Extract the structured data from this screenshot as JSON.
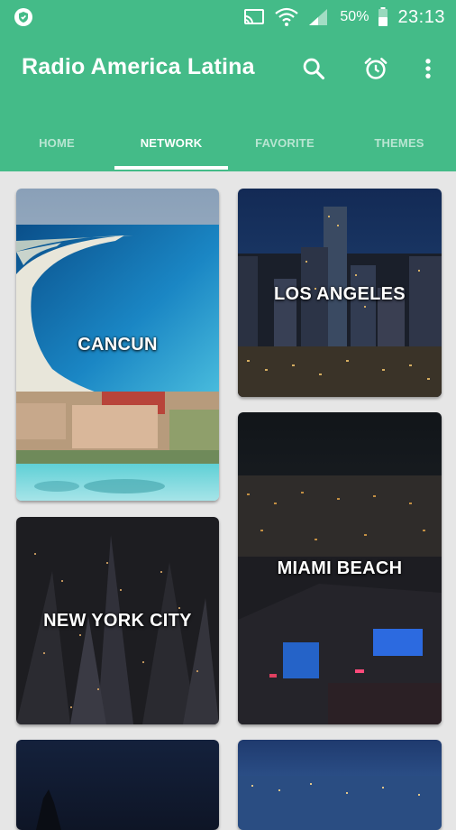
{
  "status_bar": {
    "battery_percent": "50%",
    "time": "23:13",
    "icons": [
      "shield-icon",
      "cast-icon",
      "wifi-icon",
      "signal-icon",
      "battery-icon"
    ]
  },
  "app_bar": {
    "title": "Radio America Latina",
    "background_color": "#44bb88",
    "actions": [
      "search-icon",
      "alarm-clock-icon",
      "more-vert-icon"
    ]
  },
  "tabs": [
    {
      "label": "HOME",
      "active": false
    },
    {
      "label": "NETWORK",
      "active": true
    },
    {
      "label": "FAVORITE",
      "active": false
    },
    {
      "label": "THEMES",
      "active": false
    }
  ],
  "cities": [
    {
      "name": "CANCUN",
      "image": "beach-resort-photo"
    },
    {
      "name": "LOS ANGELES",
      "image": "night-skyline-photo"
    },
    {
      "name": "NEW YORK CITY",
      "image": "night-aerial-city-photo"
    },
    {
      "name": "MIAMI BEACH",
      "image": "night-beach-city-photo"
    },
    {
      "name": "",
      "image": "night-sky-photo"
    },
    {
      "name": "",
      "image": "blue-city-lights-photo"
    }
  ]
}
